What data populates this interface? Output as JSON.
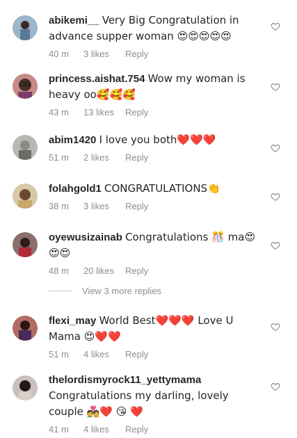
{
  "comments": [
    {
      "username": "abikemi__",
      "text": "Very Big Congratulation in advance supper woman 😍😍😍😍😍",
      "time": "40 m",
      "likes": "3 likes",
      "reply": "Reply"
    },
    {
      "username": "princess.aishat.754",
      "text": "Wow my woman is heavy oo🥰🥰🥰",
      "time": "43 m",
      "likes": "13 likes",
      "reply": "Reply"
    },
    {
      "username": "abim1420",
      "text": "I love you both❤️❤️❤️",
      "time": "51 m",
      "likes": "2 likes",
      "reply": "Reply"
    },
    {
      "username": "folahgold1",
      "text": "CONGRATULATIONS👏",
      "time": "38 m",
      "likes": "3 likes",
      "reply": "Reply"
    },
    {
      "username": "oyewusizainab",
      "text": "Congratulations 🎊 ma😍😍😍",
      "time": "48 m",
      "likes": "20 likes",
      "reply": "Reply"
    },
    {
      "username": "flexi_may",
      "text": "World Best❤️❤️❤️ Love U Mama 😍❤️❤️",
      "time": "51 m",
      "likes": "4 likes",
      "reply": "Reply"
    },
    {
      "username": "thelordismyrock11_yettymama",
      "text": "Congratulations my darling, lovely couple 💑❤️ 😘 ❤️",
      "time": "41 m",
      "likes": "4 likes",
      "reply": "Reply"
    }
  ],
  "view_more": "View 3 more replies",
  "colors": {
    "text": "#262626",
    "meta": "#8e8e8e",
    "divider": "#c7c7c7"
  }
}
